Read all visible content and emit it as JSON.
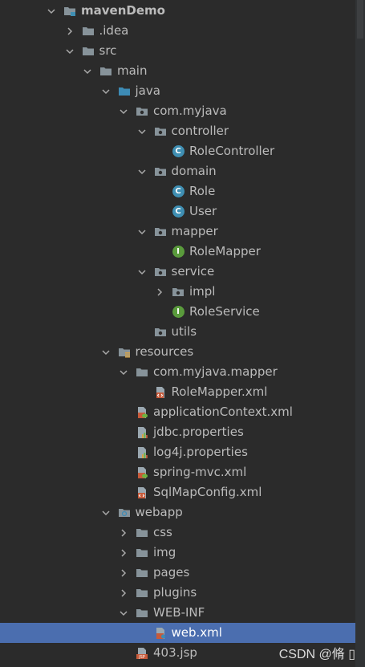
{
  "tree": [
    {
      "label": "mavenDemo",
      "depth": 0,
      "arrow": "down",
      "icon": "module-folder",
      "bold": true
    },
    {
      "label": ".idea",
      "depth": 1,
      "arrow": "right",
      "icon": "folder"
    },
    {
      "label": "src",
      "depth": 1,
      "arrow": "down",
      "icon": "folder"
    },
    {
      "label": "main",
      "depth": 2,
      "arrow": "down",
      "icon": "folder"
    },
    {
      "label": "java",
      "depth": 3,
      "arrow": "down",
      "icon": "source-folder"
    },
    {
      "label": "com.myjava",
      "depth": 4,
      "arrow": "down",
      "icon": "package"
    },
    {
      "label": "controller",
      "depth": 5,
      "arrow": "down",
      "icon": "package"
    },
    {
      "label": "RoleController",
      "depth": 6,
      "arrow": "none",
      "icon": "class",
      "letter": "C"
    },
    {
      "label": "domain",
      "depth": 5,
      "arrow": "down",
      "icon": "package"
    },
    {
      "label": "Role",
      "depth": 6,
      "arrow": "none",
      "icon": "class",
      "letter": "C"
    },
    {
      "label": "User",
      "depth": 6,
      "arrow": "none",
      "icon": "class",
      "letter": "C"
    },
    {
      "label": "mapper",
      "depth": 5,
      "arrow": "down",
      "icon": "package"
    },
    {
      "label": "RoleMapper",
      "depth": 6,
      "arrow": "none",
      "icon": "interface",
      "letter": "I"
    },
    {
      "label": "service",
      "depth": 5,
      "arrow": "down",
      "icon": "package"
    },
    {
      "label": "impl",
      "depth": 6,
      "arrow": "right",
      "icon": "package"
    },
    {
      "label": "RoleService",
      "depth": 6,
      "arrow": "none",
      "icon": "interface",
      "letter": "I"
    },
    {
      "label": "utils",
      "depth": 5,
      "arrow": "none",
      "icon": "package"
    },
    {
      "label": "resources",
      "depth": 3,
      "arrow": "down",
      "icon": "resources-folder"
    },
    {
      "label": "com.myjava.mapper",
      "depth": 4,
      "arrow": "down",
      "icon": "folder"
    },
    {
      "label": "RoleMapper.xml",
      "depth": 5,
      "arrow": "none",
      "icon": "xml-file"
    },
    {
      "label": "applicationContext.xml",
      "depth": 4,
      "arrow": "none",
      "icon": "spring-xml-file"
    },
    {
      "label": "jdbc.properties",
      "depth": 4,
      "arrow": "none",
      "icon": "properties-file"
    },
    {
      "label": "log4j.properties",
      "depth": 4,
      "arrow": "none",
      "icon": "properties-file"
    },
    {
      "label": "spring-mvc.xml",
      "depth": 4,
      "arrow": "none",
      "icon": "spring-xml-file"
    },
    {
      "label": "SqlMapConfig.xml",
      "depth": 4,
      "arrow": "none",
      "icon": "xml-file"
    },
    {
      "label": "webapp",
      "depth": 3,
      "arrow": "down",
      "icon": "web-folder"
    },
    {
      "label": "css",
      "depth": 4,
      "arrow": "right",
      "icon": "folder"
    },
    {
      "label": "img",
      "depth": 4,
      "arrow": "right",
      "icon": "folder"
    },
    {
      "label": "pages",
      "depth": 4,
      "arrow": "right",
      "icon": "folder"
    },
    {
      "label": "plugins",
      "depth": 4,
      "arrow": "right",
      "icon": "folder"
    },
    {
      "label": "WEB-INF",
      "depth": 4,
      "arrow": "down",
      "icon": "folder"
    },
    {
      "label": "web.xml",
      "depth": 5,
      "arrow": "none",
      "icon": "web-xml-file",
      "selected": true
    },
    {
      "label": "403.jsp",
      "depth": 4,
      "arrow": "none",
      "icon": "jsp-file"
    }
  ],
  "watermark": "CSDN @脩 ▯",
  "colors": {
    "background": "#2b2b2b",
    "text": "#bbbbbb",
    "selected": "#4b6eaf",
    "folder": "#87939a",
    "class": "#3f8fb3",
    "interface": "#5a9b3c"
  }
}
